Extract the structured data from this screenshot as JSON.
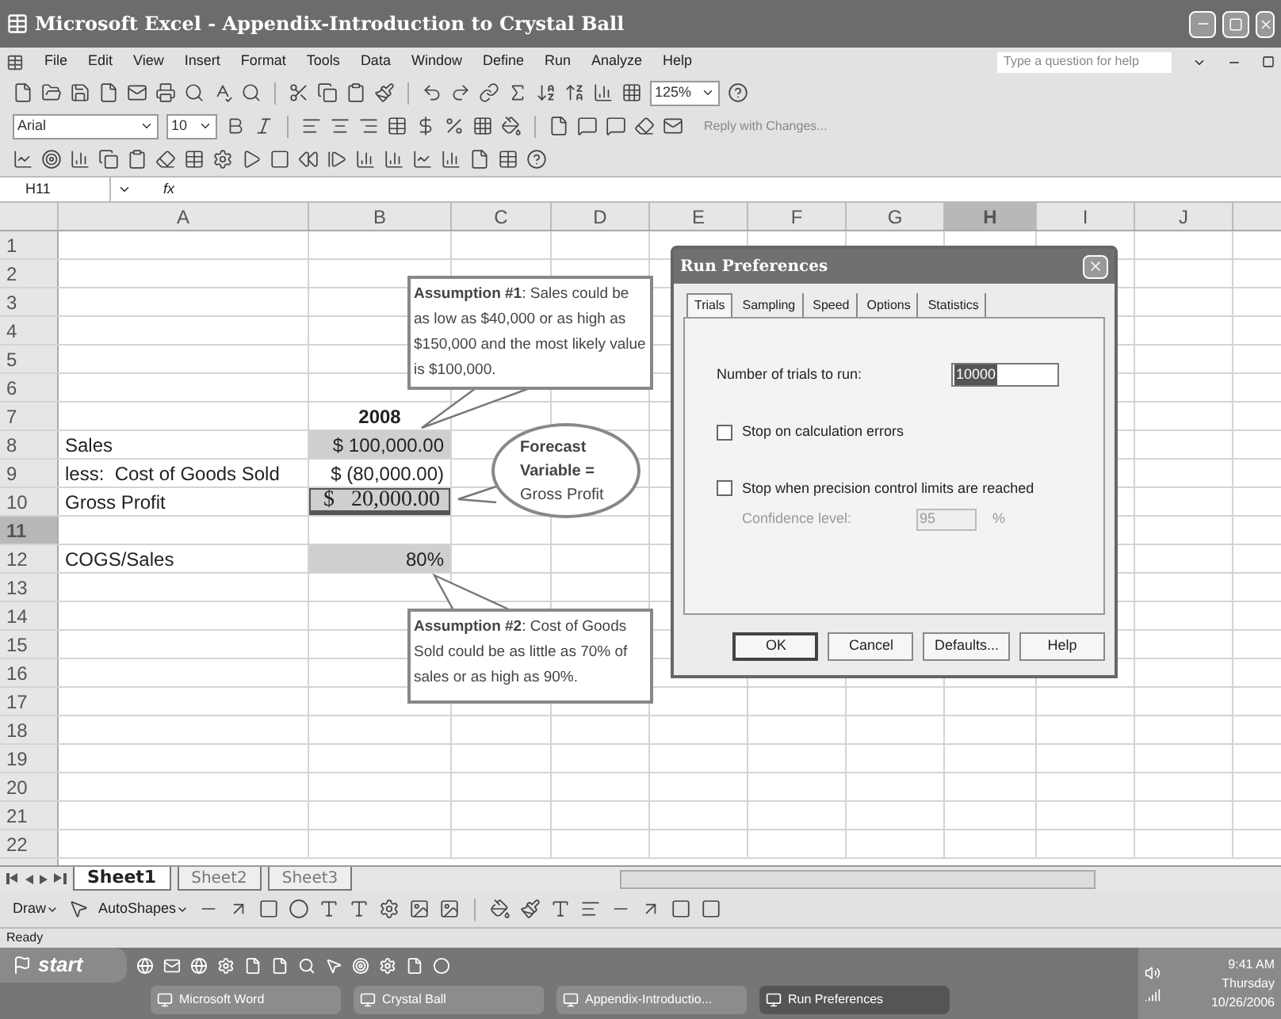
{
  "window": {
    "title": "Microsoft Excel - Appendix-Introduction to Crystal Ball"
  },
  "menu": [
    "File",
    "Edit",
    "View",
    "Insert",
    "Format",
    "Tools",
    "Data",
    "Window",
    "Define",
    "Run",
    "Analyze",
    "Help"
  ],
  "help_search": {
    "placeholder": "Type a question for help"
  },
  "standard_toolbar": {
    "zoom": "125%"
  },
  "formatting_toolbar": {
    "font": "Arial",
    "size": "10",
    "reviewing_label": "Reply with Changes..."
  },
  "formula_bar": {
    "name_box": "H11",
    "function_label": "fx"
  },
  "columns": [
    {
      "label": "A",
      "selected": false
    },
    {
      "label": "B",
      "selected": false
    },
    {
      "label": "C",
      "selected": false
    },
    {
      "label": "D",
      "selected": false
    },
    {
      "label": "E",
      "selected": false
    },
    {
      "label": "F",
      "selected": false
    },
    {
      "label": "G",
      "selected": false
    },
    {
      "label": "H",
      "selected": true
    },
    {
      "label": "I",
      "selected": false
    },
    {
      "label": "J",
      "selected": false
    }
  ],
  "rows": [
    {
      "number": "1",
      "selected": false
    },
    {
      "number": "2",
      "selected": false
    },
    {
      "number": "3",
      "selected": false
    },
    {
      "number": "4",
      "selected": false
    },
    {
      "number": "5",
      "selected": false
    },
    {
      "number": "6",
      "selected": false
    },
    {
      "number": "7",
      "selected": false,
      "b": {
        "text": "2008",
        "kind": "heading"
      }
    },
    {
      "number": "8",
      "selected": false,
      "a": "Sales",
      "b": {
        "text": "$ 100,000.00",
        "kind": "shaded"
      }
    },
    {
      "number": "9",
      "selected": false,
      "a": "less:  Cost of Goods Sold",
      "b": {
        "text": "$ (80,000.00)",
        "kind": "plain"
      }
    },
    {
      "number": "10",
      "selected": false,
      "a": "Gross Profit",
      "b": {
        "text": "$   20,000.00",
        "kind": "total"
      }
    },
    {
      "number": "11",
      "selected": true
    },
    {
      "number": "12",
      "selected": false,
      "a": "COGS/Sales",
      "b": {
        "text": "80%",
        "kind": "percent"
      }
    },
    {
      "number": "13",
      "selected": false
    },
    {
      "number": "14",
      "selected": false
    },
    {
      "number": "15",
      "selected": false
    },
    {
      "number": "16",
      "selected": false
    },
    {
      "number": "17",
      "selected": false
    },
    {
      "number": "18",
      "selected": false
    },
    {
      "number": "19",
      "selected": false
    },
    {
      "number": "20",
      "selected": false
    },
    {
      "number": "21",
      "selected": false
    },
    {
      "number": "22",
      "selected": false
    }
  ],
  "callouts": [
    {
      "kind": "box",
      "text": "**Assumption #1**:  Sales could be as low as $40,000 or as high as $150,000 and the most likely value is $100,000."
    },
    {
      "kind": "ellipse",
      "text": "**Forecast Variable =** Gross Profit"
    },
    {
      "kind": "box",
      "text": "**Assumption #2**:  Cost of Goods Sold could be as little as 70% of sales or as high as 90%."
    }
  ],
  "sheet_tabs": [
    {
      "label": "Sheet1",
      "selected": true
    },
    {
      "label": "Sheet2",
      "selected": false
    },
    {
      "label": "Sheet3",
      "selected": false
    }
  ],
  "drawing_toolbar": {
    "draw": "Draw",
    "autoshapes": "AutoShapes"
  },
  "status_bar": "Ready",
  "dialog": {
    "title": "Run Preferences",
    "tabs": [
      {
        "label": "Trials",
        "selected": true
      },
      {
        "label": "Sampling",
        "selected": false
      },
      {
        "label": "Speed",
        "selected": false
      },
      {
        "label": "Options",
        "selected": false
      },
      {
        "label": "Statistics",
        "selected": false
      }
    ],
    "trials_label": "Number of trials to run:",
    "trials_value": "10000",
    "trials_value_highlighted": true,
    "checkboxes": [
      {
        "label": "Stop on calculation errors",
        "checked": false
      },
      {
        "label": "Stop when precision control limits are reached",
        "checked": false
      }
    ],
    "confidence": {
      "label": "Confidence level:",
      "value": "95",
      "unit": "%",
      "disabled": true
    },
    "buttons": [
      {
        "label": "OK",
        "default": true
      },
      {
        "label": "Cancel",
        "default": false
      },
      {
        "label": "Defaults...",
        "default": false
      },
      {
        "label": "Help",
        "default": false
      }
    ]
  },
  "taskbar": {
    "start": "start",
    "tasks": [
      {
        "label": "Microsoft Word",
        "selected": false
      },
      {
        "label": "Crystal Ball",
        "selected": false
      },
      {
        "label": "Appendix-Introductio...",
        "selected": false
      },
      {
        "label": "Run Preferences",
        "selected": true
      }
    ],
    "clock": {
      "time": "9:41 AM",
      "day": "Thursday",
      "date": "10/26/2006"
    }
  }
}
